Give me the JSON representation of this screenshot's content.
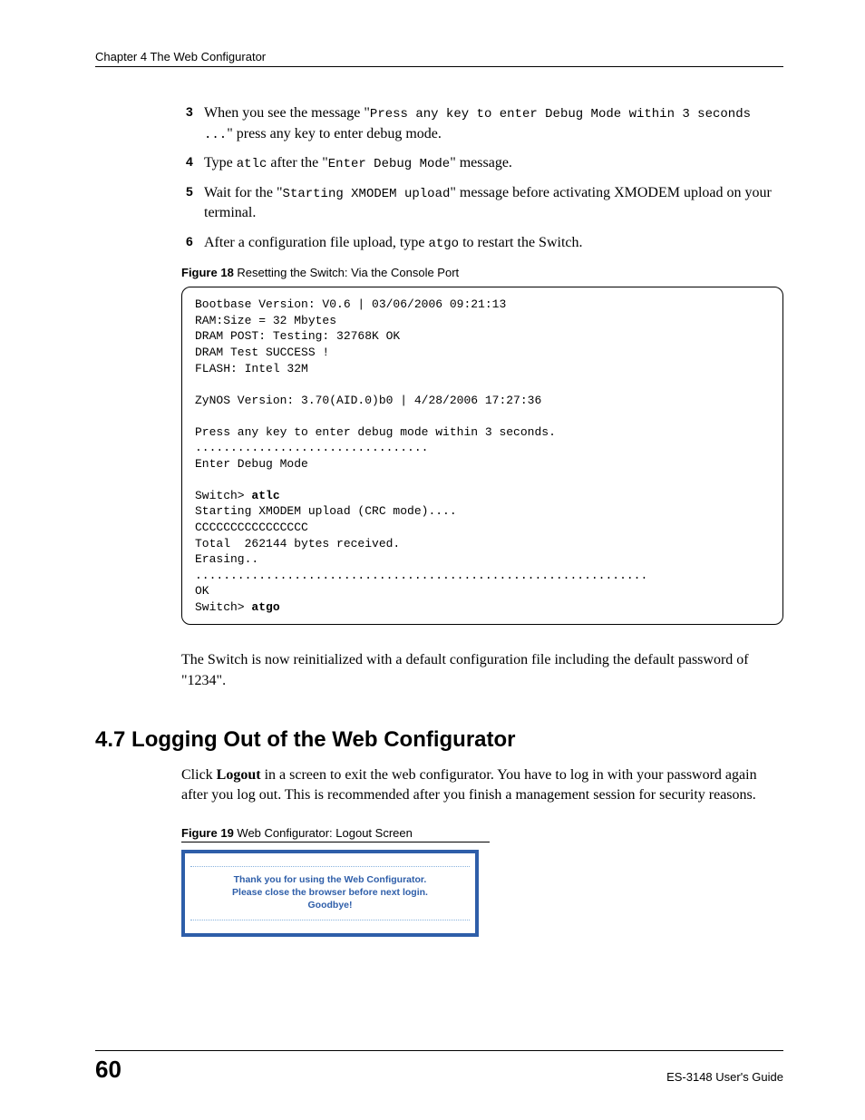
{
  "header": {
    "chapter": "Chapter 4 The Web Configurator"
  },
  "steps": {
    "s3": {
      "num": "3",
      "text_a": "When you see the message \"",
      "text_mono": "Press any key to enter Debug Mode within 3 seconds ...",
      "text_b": "\" press any key to enter debug mode."
    },
    "s4": {
      "num": "4",
      "text_a": "Type ",
      "text_mono1": "atlc",
      "text_b": " after the \"",
      "text_mono2": "Enter Debug Mode",
      "text_c": "\" message."
    },
    "s5": {
      "num": "5",
      "text_a": "Wait for the \"",
      "text_mono": "Starting XMODEM upload",
      "text_b": "\" message before activating XMODEM upload on your terminal."
    },
    "s6": {
      "num": "6",
      "text_a": "After a configuration file upload, type ",
      "text_mono": "atgo",
      "text_b": " to restart the Switch."
    }
  },
  "figure18": {
    "label": "Figure 18",
    "title": "   Resetting the Switch: Via the Console Port"
  },
  "console": {
    "l1": "Bootbase Version: V0.6 | 03/06/2006 09:21:13",
    "l2": "RAM:Size = 32 Mbytes",
    "l3": "DRAM POST: Testing: 32768K OK",
    "l4": "DRAM Test SUCCESS !",
    "l5": "FLASH: Intel 32M",
    "l6": "",
    "l7": "ZyNOS Version: 3.70(AID.0)b0 | 4/28/2006 17:27:36",
    "l8": "",
    "l9": "Press any key to enter debug mode within 3 seconds.",
    "l10": ".................................",
    "l11": "Enter Debug Mode",
    "l12": "",
    "l13a": "Switch> ",
    "l13b": "atlc",
    "l14": "Starting XMODEM upload (CRC mode)....",
    "l15": "CCCCCCCCCCCCCCCC",
    "l16": "Total  262144 bytes received.",
    "l17": "Erasing..",
    "l18": "................................................................",
    "l19": "OK",
    "l20a": "Switch> ",
    "l20b": "atgo"
  },
  "para1": "The Switch is now reinitialized with a default configuration file including the default password of \"1234\".",
  "section47": {
    "heading": "4.7  Logging Out of the Web Configurator",
    "text_a": "Click ",
    "text_bold": "Logout",
    "text_b": " in a screen to exit the web configurator. You have to log in with your password again after you log out. This is recommended after you finish a management session for security reasons."
  },
  "figure19": {
    "label": "Figure 19",
    "title": "   Web Configurator: Logout Screen"
  },
  "logout_dialog": {
    "line1": "Thank you for using the Web Configurator.",
    "line2": "Please close the browser before next login.",
    "line3": "Goodbye!"
  },
  "footer": {
    "page": "60",
    "doc": "ES-3148 User's Guide"
  }
}
